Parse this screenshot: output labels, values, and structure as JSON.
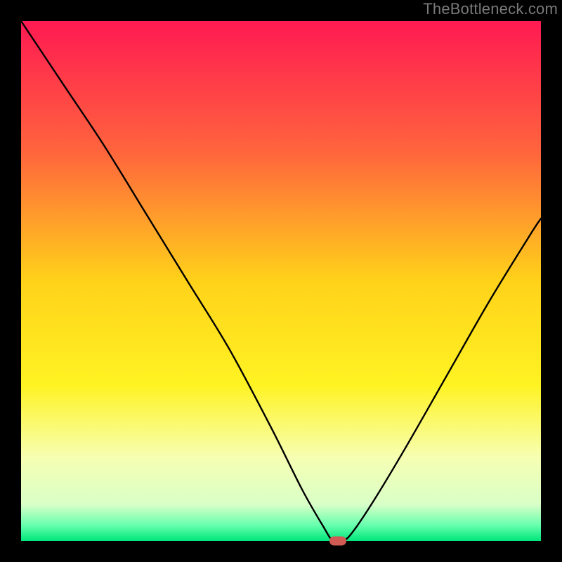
{
  "watermark": "TheBottleneck.com",
  "chart_data": {
    "type": "line",
    "title": "",
    "xlabel": "",
    "ylabel": "",
    "xlim": [
      0,
      100
    ],
    "ylim": [
      0,
      100
    ],
    "gradient_stops": [
      {
        "offset": 0,
        "color": "#ff1a52"
      },
      {
        "offset": 25,
        "color": "#ff643d"
      },
      {
        "offset": 50,
        "color": "#ffd21a"
      },
      {
        "offset": 70,
        "color": "#fff323"
      },
      {
        "offset": 84,
        "color": "#f6ffb3"
      },
      {
        "offset": 93,
        "color": "#d9ffc7"
      },
      {
        "offset": 97,
        "color": "#66ffae"
      },
      {
        "offset": 100,
        "color": "#00e67a"
      }
    ],
    "series": [
      {
        "name": "bottleneck-curve",
        "x": [
          0,
          8,
          16,
          24,
          32,
          40,
          48,
          54,
          58,
          60,
          62,
          64,
          68,
          74,
          82,
          90,
          98,
          100
        ],
        "y": [
          100,
          88,
          76,
          63,
          50,
          37,
          22,
          10,
          3,
          0,
          0,
          2,
          8,
          18,
          32,
          46,
          59,
          62
        ]
      }
    ],
    "marker": {
      "x": 61,
      "y": 0,
      "color": "#cf5b54"
    }
  }
}
